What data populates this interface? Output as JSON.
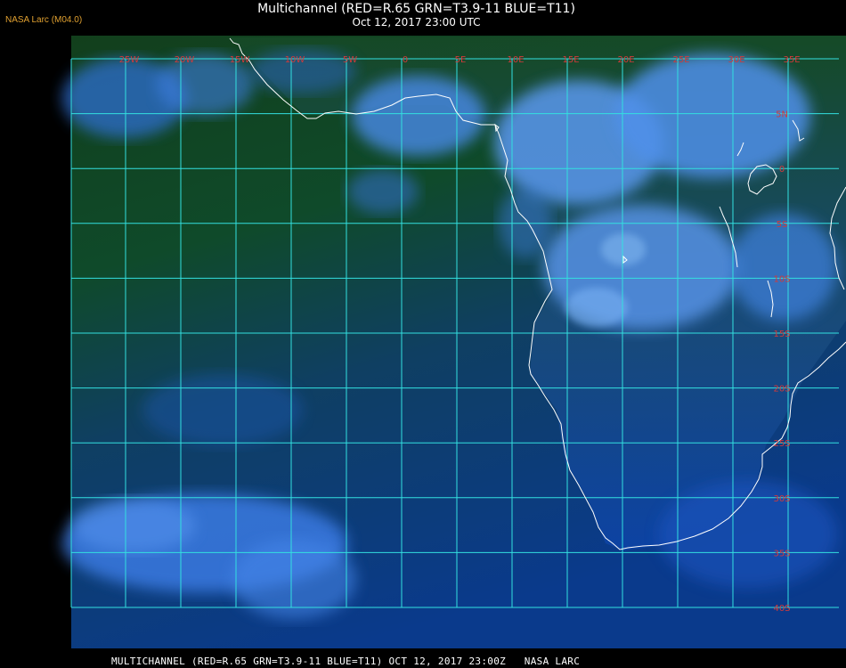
{
  "header": {
    "source_tag": "NASA Larc (M04.0)",
    "title": "Multichannel (RED=R.65 GRN=T3.9-11 BLUE=T11)",
    "datetime": "Oct 12, 2017 23:00 UTC"
  },
  "footer": {
    "caption": "MULTICHANNEL (RED=R.65 GRN=T3.9-11 BLUE=T11) OCT 12, 2017 23:00Z   NASA LARC"
  },
  "map": {
    "grid_color": "#33e0e0",
    "coast_color": "#ffffff",
    "label_color": "#d23a3a",
    "longitude_labels": [
      "25W",
      "20W",
      "15W",
      "10W",
      "5W",
      "0",
      "5E",
      "10E",
      "15E",
      "20E",
      "25E",
      "30E",
      "35E"
    ],
    "latitude_labels": [
      "5N",
      "0",
      "5S",
      "10S",
      "15S",
      "20S",
      "25S",
      "30S",
      "35S",
      "40S"
    ]
  }
}
